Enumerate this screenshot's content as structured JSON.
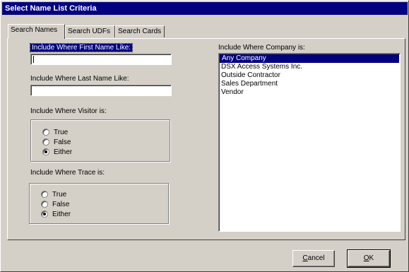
{
  "window": {
    "title": "Select Name List Criteria"
  },
  "tabs": [
    {
      "label": "Search Names",
      "active": true
    },
    {
      "label": "Search UDFs",
      "active": false
    },
    {
      "label": "Search Cards",
      "active": false
    }
  ],
  "first_name": {
    "label": "Include Where First Name Like:",
    "value": ""
  },
  "last_name": {
    "label": "Include Where Last Name Like:",
    "value": ""
  },
  "visitor": {
    "label": "Include Where Visitor is:",
    "options": [
      "True",
      "False",
      "Either"
    ],
    "selected": "Either"
  },
  "trace": {
    "label": "Include Where Trace is:",
    "options": [
      "True",
      "False",
      "Either"
    ],
    "selected": "Either"
  },
  "company": {
    "label": "Include Where Company is:",
    "items": [
      "Any Company",
      "DSX Access Systems Inc.",
      "Outside Contractor",
      "Sales Department",
      "Vendor"
    ],
    "selected": "Any Company"
  },
  "buttons": {
    "cancel_first": "C",
    "cancel_rest": "ancel",
    "ok_first": "O",
    "ok_rest": "K"
  },
  "colors": {
    "titlebar": "#000080",
    "face": "#d4d0c8",
    "selection": "#000080"
  }
}
